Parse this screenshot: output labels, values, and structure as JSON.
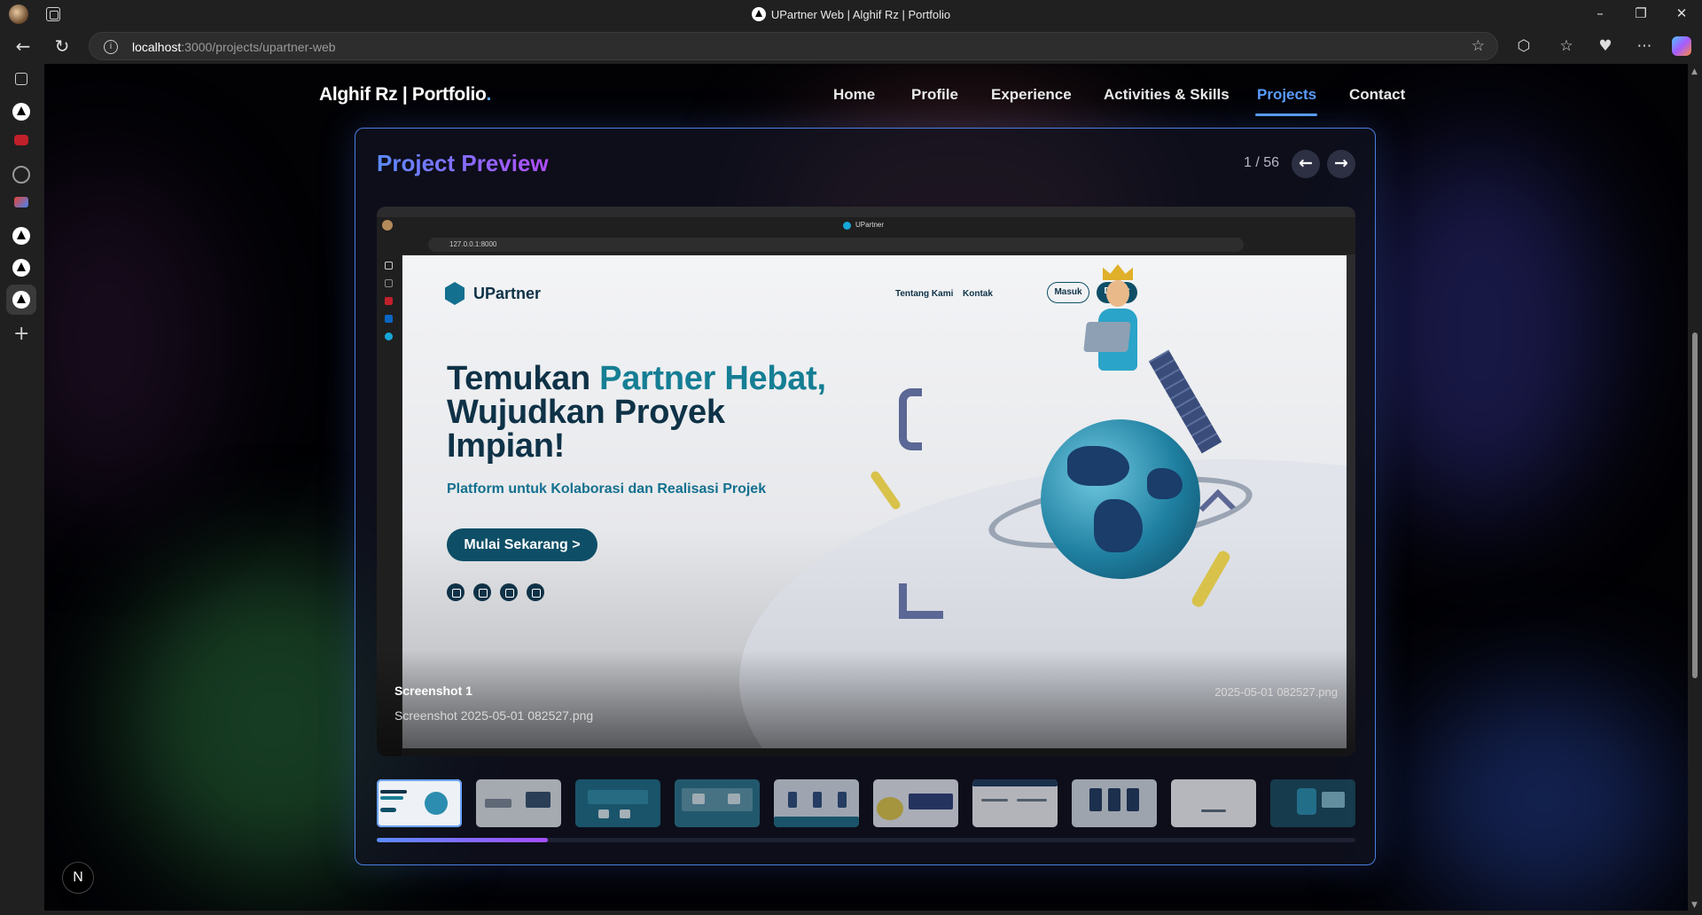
{
  "browser": {
    "window_title": "UPartner Web | Alghif Rz | Portfolio",
    "url_host": "localhost",
    "url_path": ":3000/projects/upartner-web",
    "minimize": "–",
    "restore": "❐",
    "close": "✕"
  },
  "site": {
    "logo": "Alghif Rz | Portfolio",
    "logo_dot": ".",
    "nav": [
      {
        "label": "Home"
      },
      {
        "label": "Profile"
      },
      {
        "label": "Experience"
      },
      {
        "label": "Activities & Skills"
      },
      {
        "label": "Projects",
        "active": true
      },
      {
        "label": "Contact"
      }
    ]
  },
  "preview": {
    "title": "Project Preview",
    "counter": "1 / 56",
    "current_index": 1,
    "total": 56,
    "prev_icon": "arrow-left-icon",
    "next_icon": "arrow-right-icon",
    "caption_title": "Screenshot 1",
    "caption_file": "Screenshot 2025-05-01 082527.png",
    "caption_date": "2025-05-01 082527.png",
    "scroll_progress": 0.175,
    "thumbnail_count": 10
  },
  "screenshot": {
    "tab_title": "UPartner",
    "url": "127.0.0.1:8000",
    "logo": "UPartner",
    "nav_about": "Tentang Kami",
    "nav_contact": "Kontak",
    "login": "Masuk",
    "register": "Daftar",
    "headline_1": "Temukan ",
    "headline_2": "Partner Hebat,",
    "headline_3": "Wujudkan Proyek",
    "headline_4": "Impian!",
    "subtitle": "Platform untuk Kolaborasi dan Realisasi Projek",
    "cta": "Mulai Sekarang >"
  },
  "devtools_badge": "N",
  "colors": {
    "accent": "#5b9dff",
    "gradient_start": "#5b8cff",
    "gradient_end": "#b14dff",
    "upartner_navy": "#0e3247",
    "upartner_teal": "#157e94"
  }
}
